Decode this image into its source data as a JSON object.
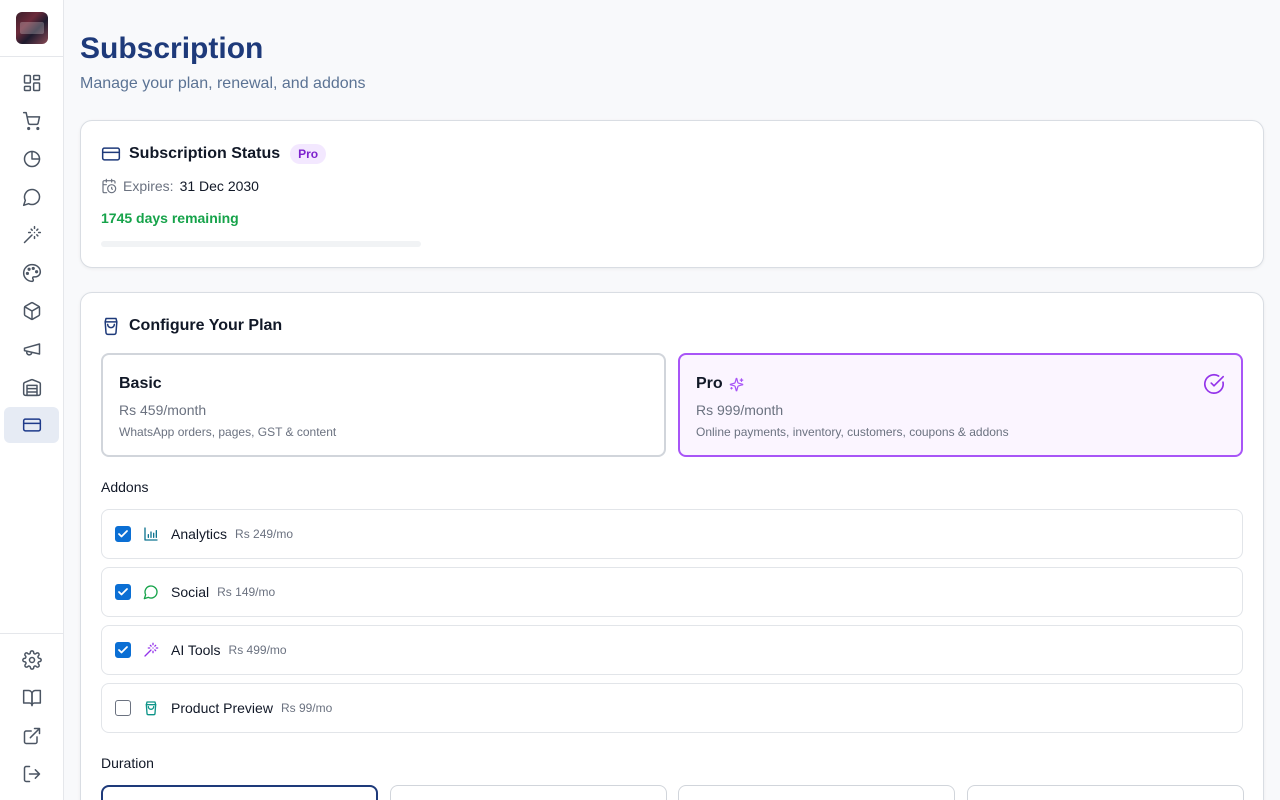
{
  "page": {
    "title": "Subscription",
    "subtitle": "Manage your plan, renewal, and addons"
  },
  "status": {
    "title": "Subscription Status",
    "badge": "Pro",
    "expires_label": "Expires:",
    "expires_date": "31 Dec 2030",
    "days_remaining": "1745 days remaining",
    "progress_fraction": 0.0
  },
  "plan": {
    "title": "Configure Your Plan",
    "options": [
      {
        "name": "Basic",
        "price": "Rs 459/month",
        "description": "WhatsApp orders, pages, GST & content",
        "selected": false
      },
      {
        "name": "Pro",
        "price": "Rs 999/month",
        "description": "Online payments, inventory, customers, coupons & addons",
        "selected": true
      }
    ],
    "addons_label": "Addons",
    "addons": [
      {
        "name": "Analytics",
        "price": "Rs 249/mo",
        "checked": true,
        "icon": "bar-chart-icon",
        "color": "#0e7490"
      },
      {
        "name": "Social",
        "price": "Rs 149/mo",
        "checked": true,
        "icon": "message-circle-icon",
        "color": "#16a34a"
      },
      {
        "name": "AI Tools",
        "price": "Rs 499/mo",
        "checked": true,
        "icon": "magic-wand-icon",
        "color": "#9333ea"
      },
      {
        "name": "Product Preview",
        "price": "Rs 99/mo",
        "checked": false,
        "icon": "shopping-bag-icon",
        "color": "#0d9488"
      }
    ],
    "duration_label": "Duration"
  },
  "colors": {
    "accent": "#1e3a7a",
    "pro_purple": "#a855f7",
    "success": "#16a34a",
    "checkbox": "#0b6fd4"
  }
}
